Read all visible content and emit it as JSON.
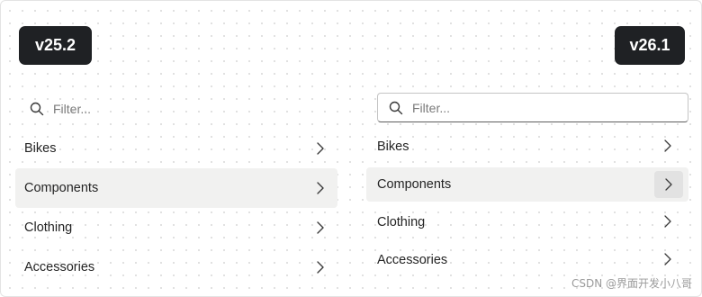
{
  "badges": {
    "left": "v25.2",
    "right": "v26.1"
  },
  "old_panel": {
    "filter_placeholder": "Filter...",
    "items": [
      {
        "label": "Bikes",
        "selected": false
      },
      {
        "label": "Components",
        "selected": true
      },
      {
        "label": "Clothing",
        "selected": false
      },
      {
        "label": "Accessories",
        "selected": false
      }
    ]
  },
  "new_panel": {
    "filter_placeholder": "Filter...",
    "items": [
      {
        "label": "Bikes",
        "selected": false
      },
      {
        "label": "Components",
        "selected": true
      },
      {
        "label": "Clothing",
        "selected": false
      },
      {
        "label": "Accessories",
        "selected": false
      }
    ]
  },
  "icons": {
    "search": "search-icon",
    "chevron": "chevron-right-icon"
  },
  "colors": {
    "badge_bg": "#1f2124",
    "selected_bg": "#f1f1f0",
    "chevron_box": "#e2e2e2"
  },
  "watermark": "CSDN @界面开发小八哥"
}
